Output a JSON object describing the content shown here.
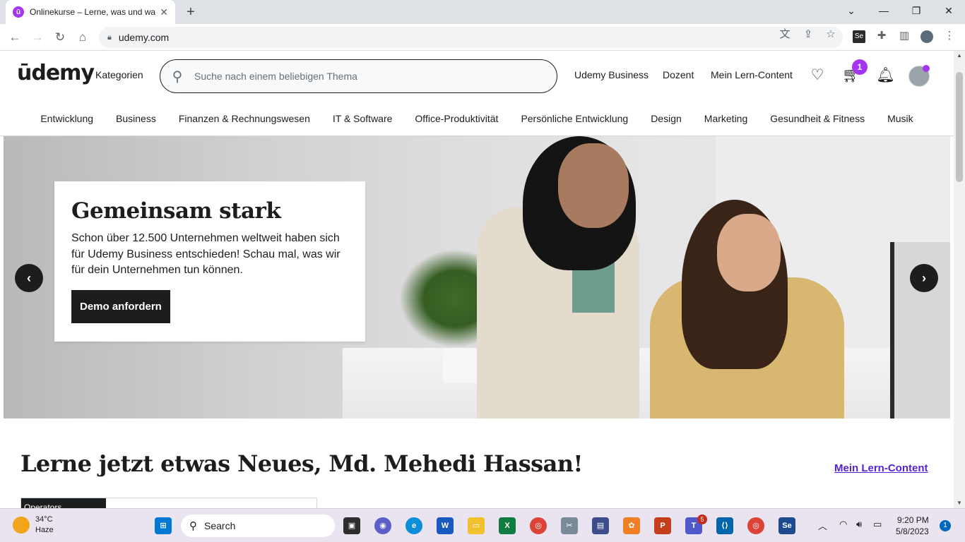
{
  "browser": {
    "tab_title": "Onlinekurse – Lerne, was und wa",
    "tab_icon_letter": "ū",
    "url": "udemy.com",
    "new_tab_glyph": "+",
    "close_glyph": "✕"
  },
  "header": {
    "logo": "ūdemy",
    "categories_label": "Kategorien",
    "search_placeholder": "Suche nach einem beliebigen Thema",
    "links": [
      "Udemy Business",
      "Dozent",
      "Mein Lern-Content"
    ],
    "cart_count": "1"
  },
  "categories": [
    "Entwicklung",
    "Business",
    "Finanzen & Rechnungswesen",
    "IT & Software",
    "Office-Produktivität",
    "Persönliche Entwicklung",
    "Design",
    "Marketing",
    "Gesundheit & Fitness",
    "Musik"
  ],
  "hero": {
    "title": "Gemeinsam stark",
    "text": "Schon über 12.500 Unternehmen weltweit haben sich für Udemy Business entschieden! Schau mal, was wir für dein Unternehmen tun können.",
    "button": "Demo anfordern",
    "prev_glyph": "‹",
    "next_glyph": "›"
  },
  "welcome": {
    "title": "Lerne jetzt etwas Neues, Md. Mehedi Hassan!",
    "link": "Mein Lern-Content",
    "partial_tab": "Operators"
  },
  "taskbar": {
    "temperature": "34°C",
    "weather": "Haze",
    "search_label": "Search",
    "teams_badge": "5",
    "time": "9:20 PM",
    "date": "5/8/2023",
    "notifications": "1"
  },
  "colors": {
    "accent": "#a435f0",
    "link": "#5624d0",
    "dark": "#1c1d1f"
  }
}
